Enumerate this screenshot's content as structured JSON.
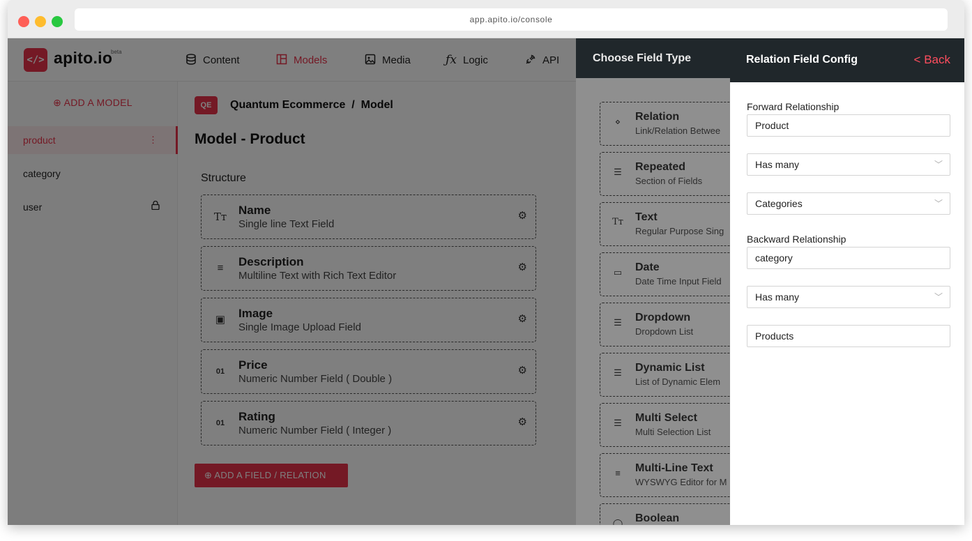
{
  "browser": {
    "url": "app.apito.io/console",
    "dots": [
      "#fe5f57",
      "#febc2e",
      "#28c840"
    ]
  },
  "brand": {
    "logo_glyph": "</>",
    "name": "apito.io",
    "badge": "beta",
    "accent": "#e8334a"
  },
  "nav": [
    {
      "label": "Content",
      "icon": "database-icon"
    },
    {
      "label": "Models",
      "icon": "layout-icon",
      "active": true
    },
    {
      "label": "Media",
      "icon": "image-icon"
    },
    {
      "label": "Logic",
      "icon": "function-icon"
    },
    {
      "label": "API",
      "icon": "plug-icon"
    }
  ],
  "sidebar": {
    "add_model": "ADD A MODEL",
    "items": [
      {
        "label": "product",
        "tail": "⋮",
        "active": true
      },
      {
        "label": "category",
        "tail": ""
      },
      {
        "label": "user",
        "tail": "🔒"
      }
    ]
  },
  "main": {
    "project_badge": "QE",
    "breadcrumb": "Quantum Ecommerce  /  Model",
    "title": "Model - Product",
    "structure_label": "Structure",
    "fields": [
      {
        "icon": "text-icon",
        "glyph": "Tт",
        "name": "Name",
        "desc": "Single line Text Field"
      },
      {
        "icon": "paragraph-icon",
        "glyph": "≡",
        "name": "Description",
        "desc": "Multiline Text with Rich Text Editor"
      },
      {
        "icon": "image-file-icon",
        "glyph": "▣",
        "name": "Image",
        "desc": "Single Image Upload Field"
      },
      {
        "icon": "number-icon",
        "glyph": "01",
        "name": "Price",
        "desc": "Numeric Number Field ( Double )"
      },
      {
        "icon": "number-icon",
        "glyph": "01",
        "name": "Rating",
        "desc": "Numeric Number Field ( Integer )"
      }
    ],
    "add_field": "ADD A FIELD / RELATION"
  },
  "chooser": {
    "title": "Choose Field Type",
    "types": [
      {
        "icon": "relation-icon",
        "glyph": "⋄",
        "name": "Relation",
        "desc": "Link/Relation Betwee"
      },
      {
        "icon": "repeated-icon",
        "glyph": "☰",
        "name": "Repeated",
        "desc": "Section of Fields"
      },
      {
        "icon": "text-icon",
        "glyph": "Tт",
        "name": "Text",
        "desc": "Regular Purpose Sing"
      },
      {
        "icon": "calendar-icon",
        "glyph": "▭",
        "name": "Date",
        "desc": "Date Time Input Field"
      },
      {
        "icon": "list-icon",
        "glyph": "☰",
        "name": "Dropdown",
        "desc": "Dropdown List"
      },
      {
        "icon": "list-icon",
        "glyph": "☰",
        "name": "Dynamic List",
        "desc": "List of Dynamic Elem"
      },
      {
        "icon": "list-icon",
        "glyph": "☰",
        "name": "Multi Select",
        "desc": "Multi Selection List"
      },
      {
        "icon": "paragraph-icon",
        "glyph": "≡",
        "name": "Multi-Line Text",
        "desc": "WYSWYG Editor for M"
      },
      {
        "icon": "toggle-icon",
        "glyph": "◯",
        "name": "Boolean",
        "desc": ""
      }
    ]
  },
  "config": {
    "title": "Relation Field Config",
    "back": "< Back",
    "forward_label": "Forward Relationship",
    "forward_name": "Product",
    "forward_type": "Has many",
    "forward_target": "Categories",
    "backward_label": "Backward Relationship",
    "backward_name": "category",
    "backward_type": "Has many",
    "backward_target": "Products"
  }
}
